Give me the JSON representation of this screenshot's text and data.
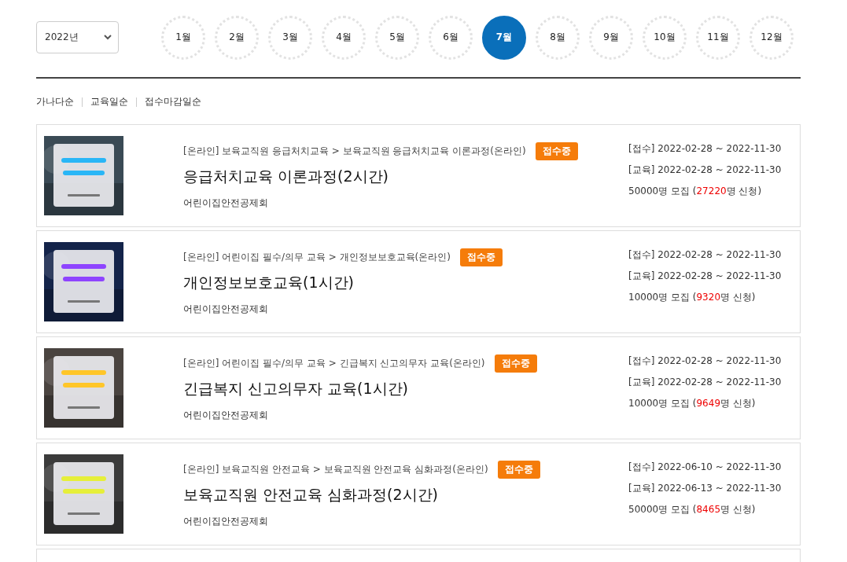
{
  "year_select": {
    "value": "2022년"
  },
  "months": [
    {
      "label": "1월",
      "selected": false
    },
    {
      "label": "2월",
      "selected": false
    },
    {
      "label": "3월",
      "selected": false
    },
    {
      "label": "4월",
      "selected": false
    },
    {
      "label": "5월",
      "selected": false
    },
    {
      "label": "6월",
      "selected": false
    },
    {
      "label": "7월",
      "selected": true
    },
    {
      "label": "8월",
      "selected": false
    },
    {
      "label": "9월",
      "selected": false
    },
    {
      "label": "10월",
      "selected": false
    },
    {
      "label": "11월",
      "selected": false
    },
    {
      "label": "12월",
      "selected": false
    }
  ],
  "sort_options": [
    "가나다순",
    "교육일순",
    "접수마감일순"
  ],
  "courses": [
    {
      "thumbnail": {
        "kind": "picture"
      },
      "category": "[온라인] 보육교직원 응급처치교육 > 보육교직원 응급처치교육 이론과정(온라인)",
      "status": "접수중",
      "title": "응급처치교육 이론과정(2시간)",
      "org": "어린이집안전공제회",
      "dates": [
        "[접수] 2022-02-28 ~ 2022-11-30",
        "[교육] 2022-02-28 ~ 2022-11-30"
      ],
      "recruit_prefix": "50000명 모집 (",
      "applied": "27220",
      "applied_suffix": "명 신청)"
    },
    {
      "thumbnail": {
        "kind": "picture"
      },
      "category": "[온라인] 어린이집 필수/의무 교육 > 개인정보보호교육(온라인)",
      "status": "접수중",
      "title": "개인정보보호교육(1시간)",
      "org": "어린이집안전공제회",
      "dates": [
        "[접수] 2022-02-28 ~ 2022-11-30",
        "[교육] 2022-02-28 ~ 2022-11-30"
      ],
      "recruit_prefix": "10000명 모집 (",
      "applied": "9320",
      "applied_suffix": "명 신청)"
    },
    {
      "thumbnail": {
        "kind": "picture"
      },
      "category": "[온라인] 어린이집 필수/의무 교육 > 긴급복지 신고의무자 교육(온라인)",
      "status": "접수중",
      "title": "긴급복지 신고의무자 교육(1시간)",
      "org": "어린이집안전공제회",
      "dates": [
        "[접수] 2022-02-28 ~ 2022-11-30",
        "[교육] 2022-02-28 ~ 2022-11-30"
      ],
      "recruit_prefix": "10000명 모집 (",
      "applied": "9649",
      "applied_suffix": "명 신청)"
    },
    {
      "thumbnail": {
        "kind": "picture"
      },
      "category": "[온라인] 보육교직원 안전교육 > 보육교직원 안전교육 심화과정(온라인)",
      "status": "접수중",
      "title": "보육교직원 안전교육 심화과정(2시간)",
      "org": "어린이집안전공제회",
      "dates": [
        "[접수] 2022-06-10 ~ 2022-11-30",
        "[교육] 2022-06-13 ~ 2022-11-30"
      ],
      "recruit_prefix": "50000명 모집 (",
      "applied": "8465",
      "applied_suffix": "명 신청)"
    }
  ]
}
